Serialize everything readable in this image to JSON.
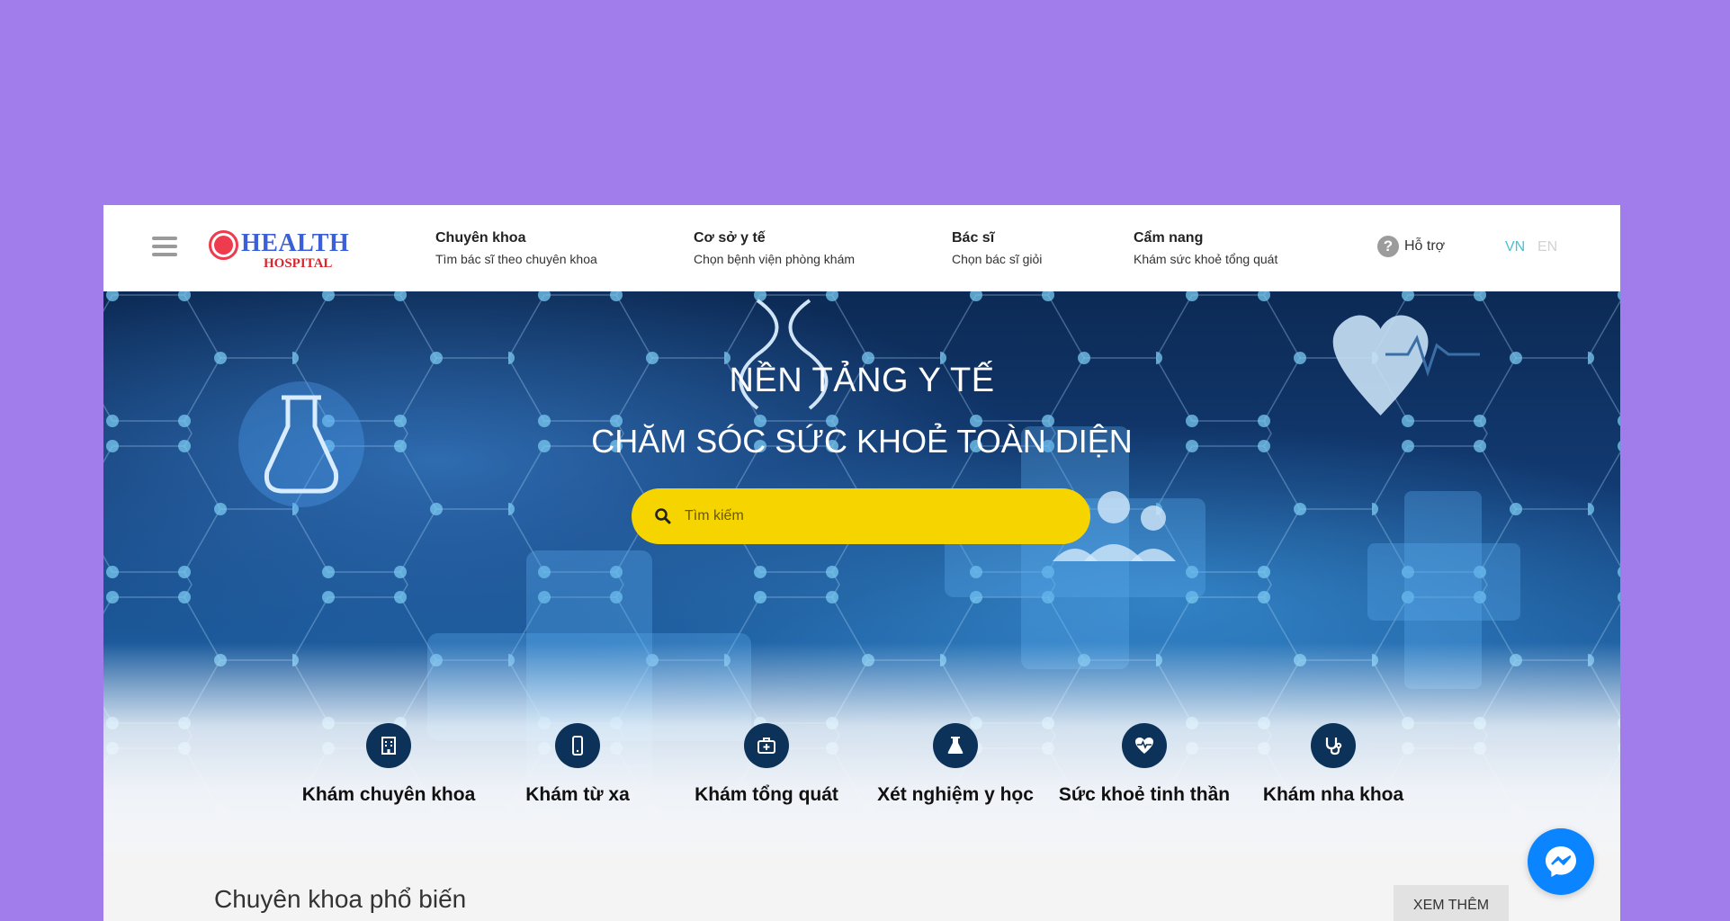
{
  "header": {
    "logo": {
      "main": "HEALTH",
      "sub": "HOSPITAL"
    },
    "nav": [
      {
        "title": "Chuyên khoa",
        "subtitle": "Tìm bác sĩ theo chuyên khoa"
      },
      {
        "title": "Cơ sở y tế",
        "subtitle": "Chọn bệnh viện phòng khám"
      },
      {
        "title": "Bác sĩ",
        "subtitle": "Chọn bác sĩ giỏi"
      },
      {
        "title": "Cẩm nang",
        "subtitle": "Khám sức khoẻ tổng quát"
      }
    ],
    "support_label": "Hỗ trợ",
    "help_icon_glyph": "?",
    "lang": {
      "vn": "VN",
      "en": "EN",
      "active": "VN"
    }
  },
  "hero": {
    "title_line1": "NỀN TẢNG Y TẾ",
    "title_line2": "CHĂM SÓC SỨC KHOẺ TOÀN DIỆN",
    "search_placeholder": "Tìm kiếm"
  },
  "services": [
    {
      "label": "Khám chuyên khoa",
      "icon": "hospital-building-icon"
    },
    {
      "label": "Khám từ xa",
      "icon": "mobile-phone-icon"
    },
    {
      "label": "Khám tổng quát",
      "icon": "medical-kit-icon"
    },
    {
      "label": "Xét nghiệm y học",
      "icon": "flask-icon"
    },
    {
      "label": "Sức khoẻ tinh thần",
      "icon": "heartbeat-icon"
    },
    {
      "label": "Khám nha khoa",
      "icon": "stethoscope-icon"
    }
  ],
  "popular": {
    "title": "Chuyên khoa phổ biến",
    "more_button": "XEM THÊM"
  },
  "colors": {
    "page_background": "#a07deb",
    "search_yellow": "#f5d400",
    "service_icon_bg": "#0d3259",
    "lang_active": "#45c3d2",
    "messenger_blue": "#0a84ff"
  }
}
